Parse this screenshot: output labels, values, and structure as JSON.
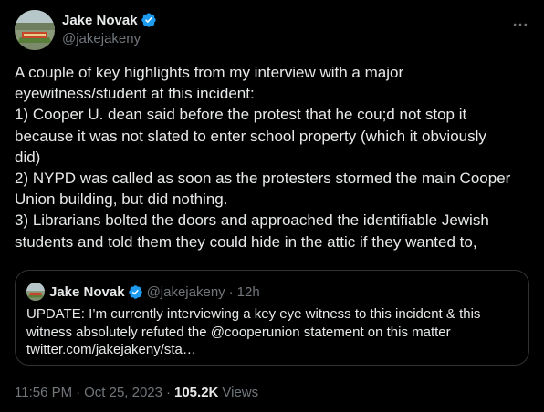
{
  "author": {
    "display_name": "Jake Novak",
    "handle": "@jakejakeny"
  },
  "tweet": {
    "lines": [
      "A couple of key highlights from my interview with a major",
      "eyewitness/student at this incident:",
      "1) Cooper U. dean said before the protest that he cou;d not stop it",
      "because it was not slated to enter school property (which it obviously",
      "did)",
      "2) NYPD was called as soon as the protesters stormed the main Cooper",
      "Union building, but did nothing.",
      "3) Librarians bolted the doors and approached the identifiable Jewish",
      "students and told them they could hide in the attic if they wanted to,"
    ]
  },
  "quote": {
    "display_name": "Jake Novak",
    "handle": "@jakejakeny",
    "separator": "·",
    "time": "12h",
    "lines": [
      "UPDATE: I’m currently interviewing a key eye witness to this incident & this",
      "witness absolutely refuted the @cooperunion statement on this matter",
      "twitter.com/jakejakeny/sta…"
    ]
  },
  "meta": {
    "time": "11:56 PM",
    "sep1": "·",
    "date": "Oct 25, 2023",
    "sep2": "·",
    "views_count": "105.2K",
    "views_label": "Views"
  },
  "icons": {
    "verified": "verified-badge-icon",
    "more": "more-dots-icon"
  },
  "colors": {
    "background": "#000000",
    "text_primary": "#e7e9ea",
    "text_secondary": "#71767b",
    "verified_blue": "#1d9bf0",
    "border": "#2f3336"
  }
}
